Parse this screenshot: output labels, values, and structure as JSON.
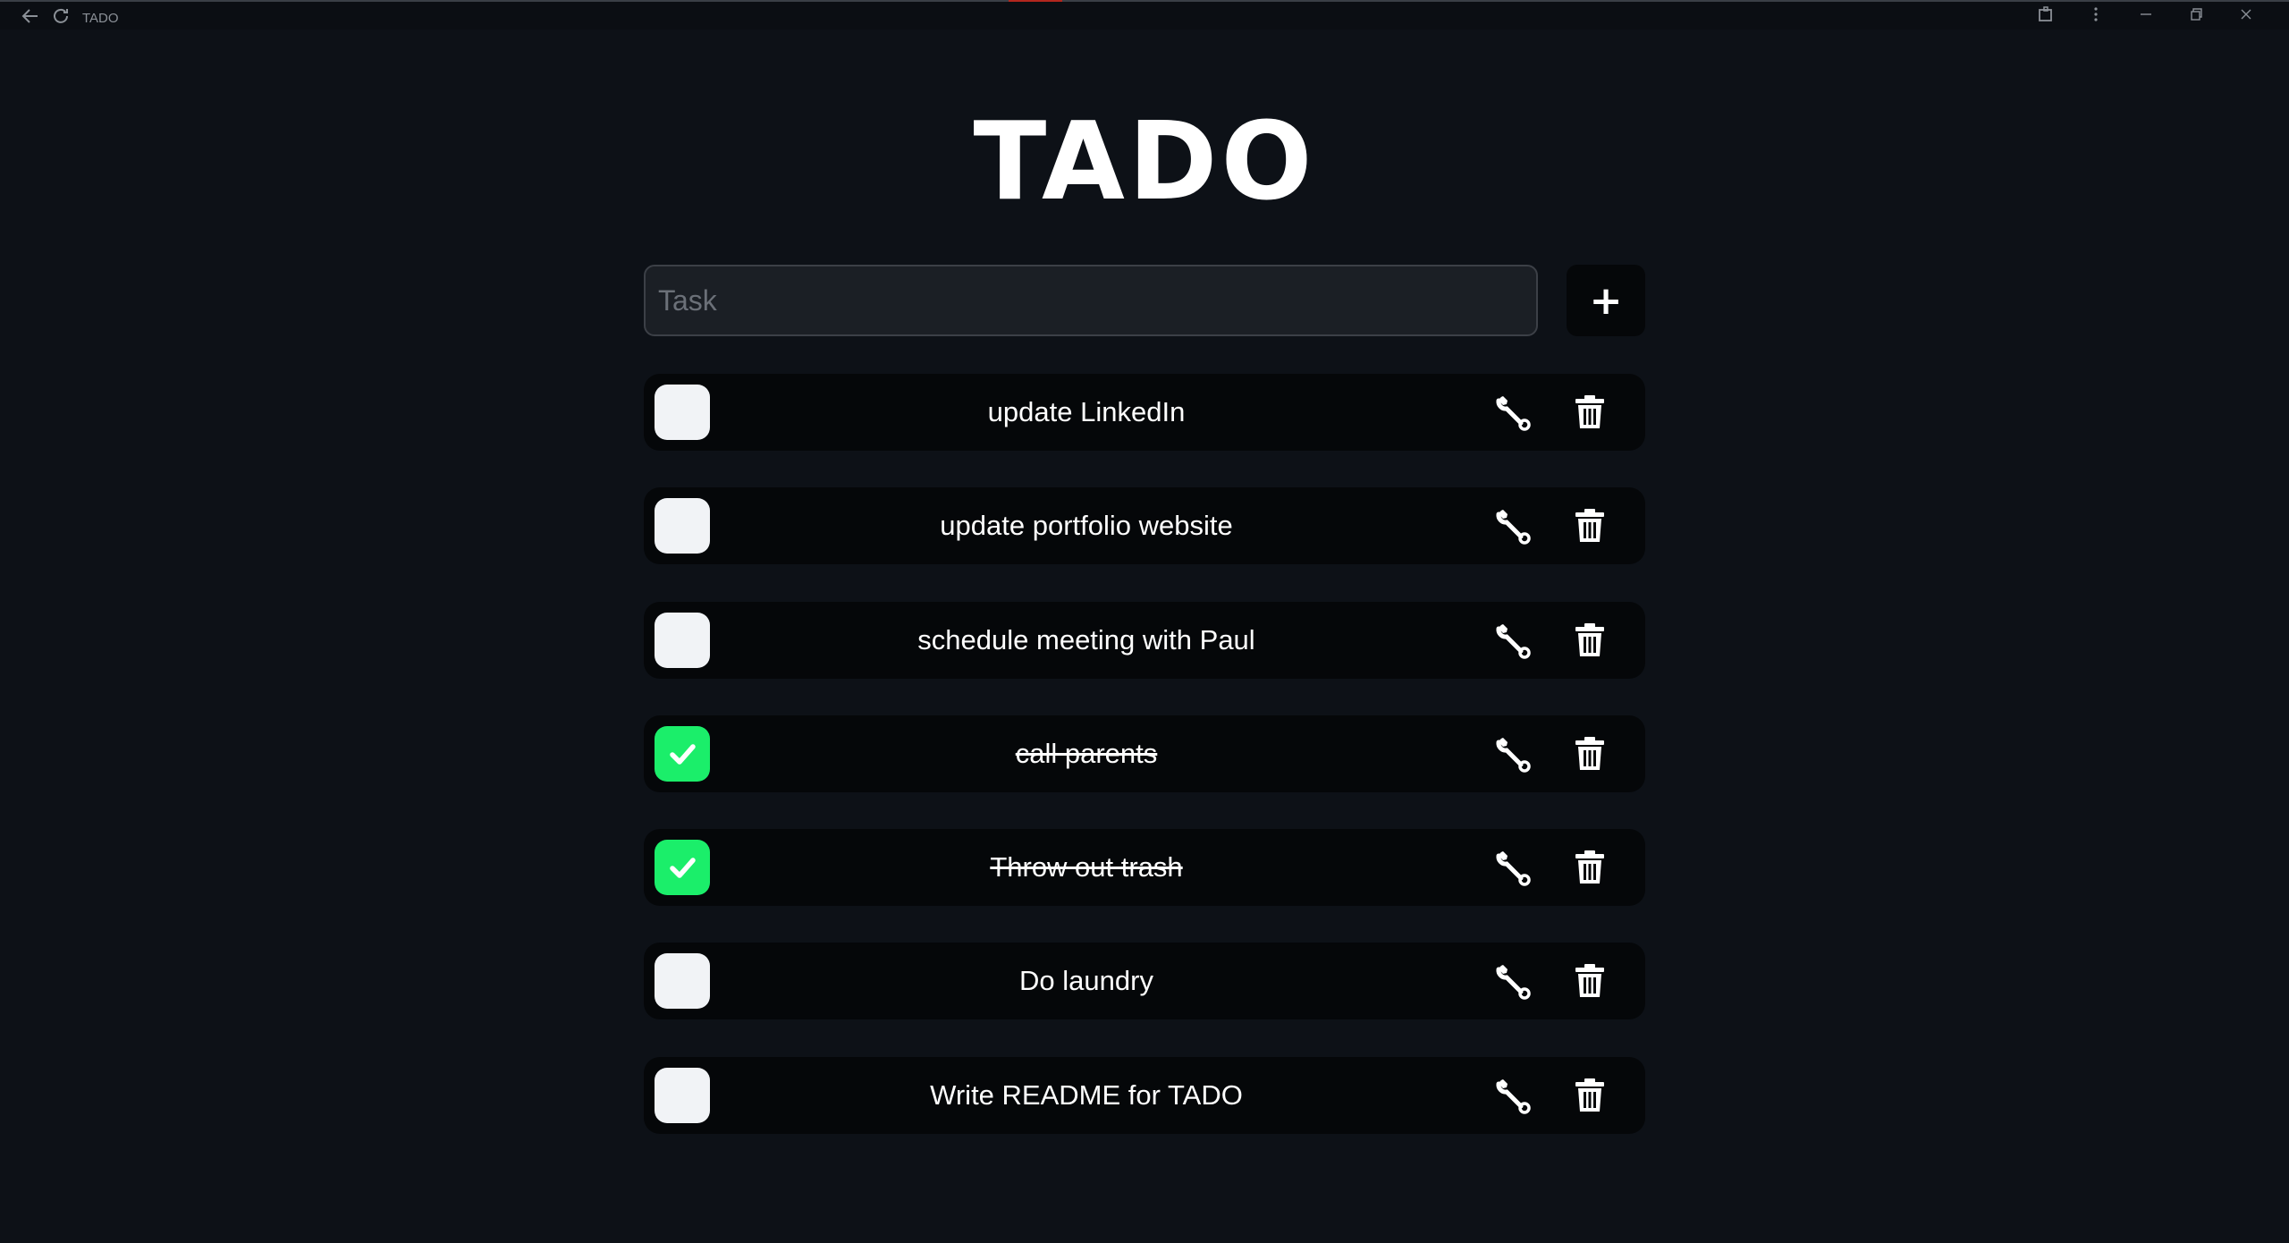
{
  "window": {
    "title": "TADO",
    "icons": [
      "back-arrow-icon",
      "refresh-icon",
      "extensions-icon",
      "more-options-icon",
      "minimize-icon",
      "restore-icon",
      "close-icon"
    ]
  },
  "app": {
    "title": "TADO"
  },
  "new_task": {
    "placeholder": "Task",
    "value": "",
    "add_label": "+"
  },
  "colors": {
    "background": "#0d1117",
    "row": "#050709",
    "checkbox_unchecked": "#f1f3f6",
    "checkbox_checked": "#1bee6a"
  },
  "tasks": [
    {
      "label": "update LinkedIn",
      "done": false
    },
    {
      "label": "update portfolio website",
      "done": false
    },
    {
      "label": "schedule meeting with Paul",
      "done": false
    },
    {
      "label": "call parents",
      "done": true
    },
    {
      "label": "Throw out trash",
      "done": true
    },
    {
      "label": "Do laundry",
      "done": false
    },
    {
      "label": "Write README for TADO",
      "done": false
    }
  ]
}
